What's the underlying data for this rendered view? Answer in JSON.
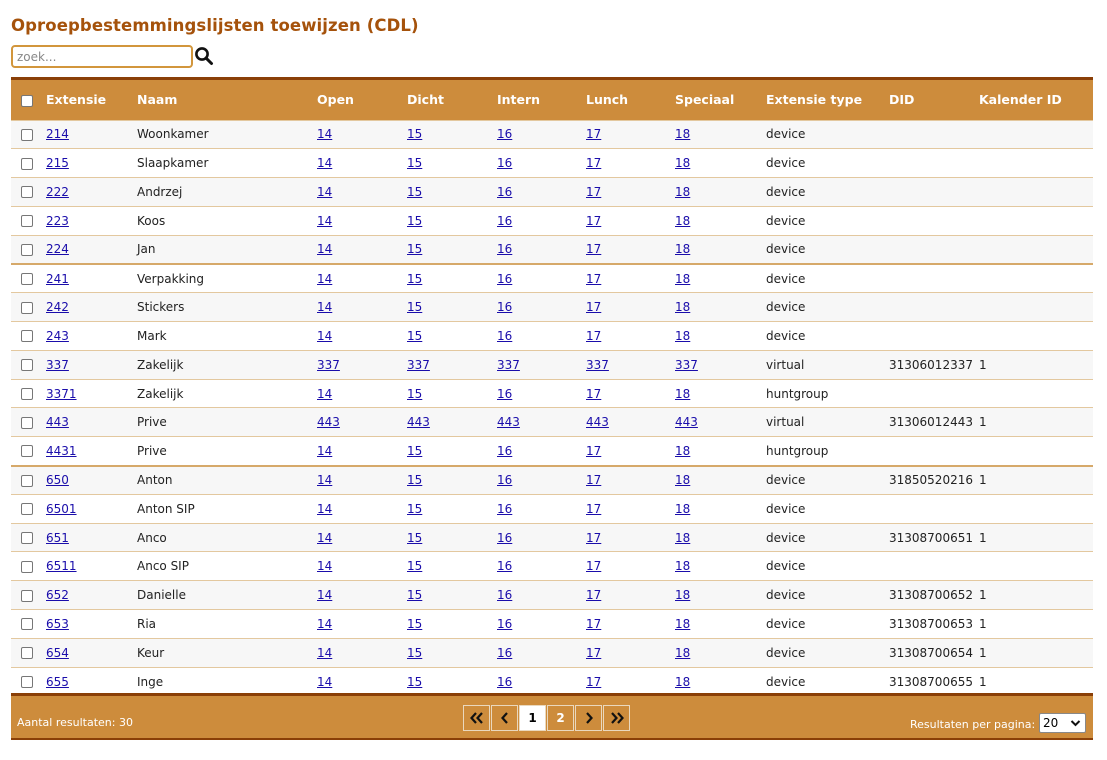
{
  "page": {
    "title": "Oproepbestemmingslijsten toewijzen (CDL)"
  },
  "search": {
    "placeholder": "zoek...",
    "value": "",
    "icon": "search-icon"
  },
  "table": {
    "columns": [
      "Extensie",
      "Naam",
      "Open",
      "Dicht",
      "Intern",
      "Lunch",
      "Speciaal",
      "Extensie type",
      "DID",
      "Kalender ID"
    ],
    "rows": [
      {
        "ext": "214",
        "naam": "Woonkamer",
        "open": "14",
        "dicht": "15",
        "intern": "16",
        "lunch": "17",
        "speciaal": "18",
        "type": "device",
        "did": "",
        "kal": ""
      },
      {
        "ext": "215",
        "naam": "Slaapkamer",
        "open": "14",
        "dicht": "15",
        "intern": "16",
        "lunch": "17",
        "speciaal": "18",
        "type": "device",
        "did": "",
        "kal": ""
      },
      {
        "ext": "222",
        "naam": "Andrzej",
        "open": "14",
        "dicht": "15",
        "intern": "16",
        "lunch": "17",
        "speciaal": "18",
        "type": "device",
        "did": "",
        "kal": ""
      },
      {
        "ext": "223",
        "naam": "Koos",
        "open": "14",
        "dicht": "15",
        "intern": "16",
        "lunch": "17",
        "speciaal": "18",
        "type": "device",
        "did": "",
        "kal": ""
      },
      {
        "ext": "224",
        "naam": "Jan",
        "open": "14",
        "dicht": "15",
        "intern": "16",
        "lunch": "17",
        "speciaal": "18",
        "type": "device",
        "did": "",
        "kal": ""
      },
      {
        "ext": "241",
        "naam": "Verpakking",
        "open": "14",
        "dicht": "15",
        "intern": "16",
        "lunch": "17",
        "speciaal": "18",
        "type": "device",
        "did": "",
        "kal": ""
      },
      {
        "ext": "242",
        "naam": "Stickers",
        "open": "14",
        "dicht": "15",
        "intern": "16",
        "lunch": "17",
        "speciaal": "18",
        "type": "device",
        "did": "",
        "kal": ""
      },
      {
        "ext": "243",
        "naam": "Mark",
        "open": "14",
        "dicht": "15",
        "intern": "16",
        "lunch": "17",
        "speciaal": "18",
        "type": "device",
        "did": "",
        "kal": ""
      },
      {
        "ext": "337",
        "naam": "Zakelijk",
        "open": "337",
        "dicht": "337",
        "intern": "337",
        "lunch": "337",
        "speciaal": "337",
        "type": "virtual",
        "did": "31306012337",
        "kal": "1"
      },
      {
        "ext": "3371",
        "naam": "Zakelijk",
        "open": "14",
        "dicht": "15",
        "intern": "16",
        "lunch": "17",
        "speciaal": "18",
        "type": "huntgroup",
        "did": "",
        "kal": ""
      },
      {
        "ext": "443",
        "naam": "Prive",
        "open": "443",
        "dicht": "443",
        "intern": "443",
        "lunch": "443",
        "speciaal": "443",
        "type": "virtual",
        "did": "31306012443",
        "kal": "1"
      },
      {
        "ext": "4431",
        "naam": "Prive",
        "open": "14",
        "dicht": "15",
        "intern": "16",
        "lunch": "17",
        "speciaal": "18",
        "type": "huntgroup",
        "did": "",
        "kal": ""
      },
      {
        "ext": "650",
        "naam": "Anton",
        "open": "14",
        "dicht": "15",
        "intern": "16",
        "lunch": "17",
        "speciaal": "18",
        "type": "device",
        "did": "31850520216",
        "kal": "1"
      },
      {
        "ext": "6501",
        "naam": "Anton SIP",
        "open": "14",
        "dicht": "15",
        "intern": "16",
        "lunch": "17",
        "speciaal": "18",
        "type": "device",
        "did": "",
        "kal": ""
      },
      {
        "ext": "651",
        "naam": "Anco",
        "open": "14",
        "dicht": "15",
        "intern": "16",
        "lunch": "17",
        "speciaal": "18",
        "type": "device",
        "did": "31308700651",
        "kal": "1"
      },
      {
        "ext": "6511",
        "naam": "Anco SIP",
        "open": "14",
        "dicht": "15",
        "intern": "16",
        "lunch": "17",
        "speciaal": "18",
        "type": "device",
        "did": "",
        "kal": ""
      },
      {
        "ext": "652",
        "naam": "Danielle",
        "open": "14",
        "dicht": "15",
        "intern": "16",
        "lunch": "17",
        "speciaal": "18",
        "type": "device",
        "did": "31308700652",
        "kal": "1"
      },
      {
        "ext": "653",
        "naam": "Ria",
        "open": "14",
        "dicht": "15",
        "intern": "16",
        "lunch": "17",
        "speciaal": "18",
        "type": "device",
        "did": "31308700653",
        "kal": "1"
      },
      {
        "ext": "654",
        "naam": "Keur",
        "open": "14",
        "dicht": "15",
        "intern": "16",
        "lunch": "17",
        "speciaal": "18",
        "type": "device",
        "did": "31308700654",
        "kal": "1"
      },
      {
        "ext": "655",
        "naam": "Inge",
        "open": "14",
        "dicht": "15",
        "intern": "16",
        "lunch": "17",
        "speciaal": "18",
        "type": "device",
        "did": "31308700655",
        "kal": "1"
      }
    ]
  },
  "footer": {
    "result_count": "Aantal resultaten: 30",
    "pager": {
      "first_icon": "double-chevron-left-icon",
      "prev_icon": "chevron-left-icon",
      "pages": [
        "1",
        "2"
      ],
      "current_page": "1",
      "next_icon": "chevron-right-icon",
      "last_icon": "double-chevron-right-icon"
    },
    "per_page_label": "Resultaten per pagina:",
    "per_page_value": "20"
  },
  "colors": {
    "title": "#a5520b",
    "header_bg": "#cd8c3c",
    "header_border": "#8a3f07",
    "link": "#1a0dab"
  }
}
